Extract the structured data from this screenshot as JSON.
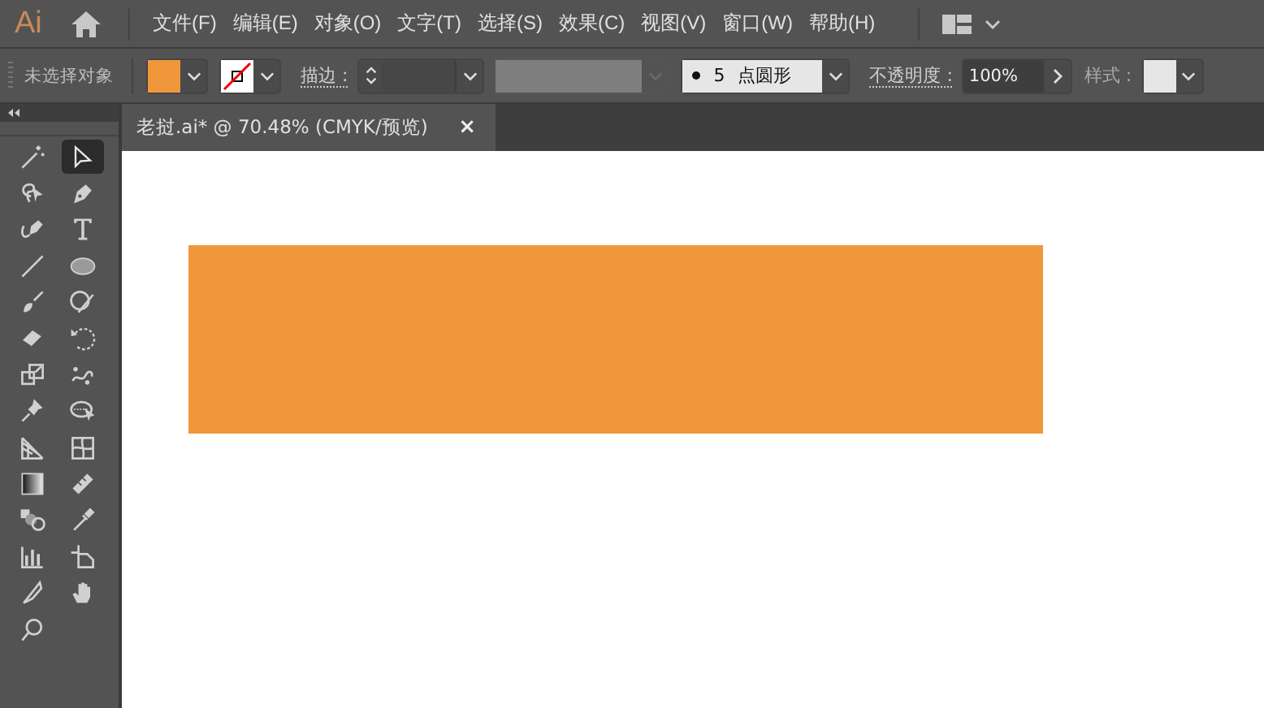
{
  "app": {
    "logo": "Ai"
  },
  "menu": [
    {
      "label": "文件(F)"
    },
    {
      "label": "编辑(E)"
    },
    {
      "label": "对象(O)"
    },
    {
      "label": "文字(T)"
    },
    {
      "label": "选择(S)"
    },
    {
      "label": "效果(C)"
    },
    {
      "label": "视图(V)"
    },
    {
      "label": "窗口(W)"
    },
    {
      "label": "帮助(H)"
    }
  ],
  "control_bar": {
    "selection": "未选择对象",
    "stroke_label": "描边 :",
    "brush": {
      "size": "5",
      "name": "点圆形"
    },
    "opacity_label": "不透明度 :",
    "opacity": "100%",
    "style_label": "样式 :"
  },
  "document_tab": {
    "title": "老挝.ai* @ 70.48% (CMYK/预览)",
    "close": "×"
  },
  "tools": [
    {
      "selected": false
    },
    {
      "selected": true
    },
    {
      "selected": false
    },
    {
      "selected": false
    },
    {
      "selected": false
    },
    {
      "selected": false
    },
    {
      "selected": false
    },
    {
      "selected": false
    },
    {
      "selected": false
    },
    {
      "selected": false
    },
    {
      "selected": false
    },
    {
      "selected": false
    },
    {
      "selected": false
    },
    {
      "selected": false
    },
    {
      "selected": false
    },
    {
      "selected": false
    },
    {
      "selected": false
    },
    {
      "selected": false
    },
    {
      "selected": false
    },
    {
      "selected": false
    },
    {
      "selected": false
    },
    {
      "selected": false
    },
    {
      "selected": false
    },
    {
      "selected": false
    },
    {
      "selected": false
    },
    {
      "selected": false
    },
    {
      "selected": false
    }
  ]
}
